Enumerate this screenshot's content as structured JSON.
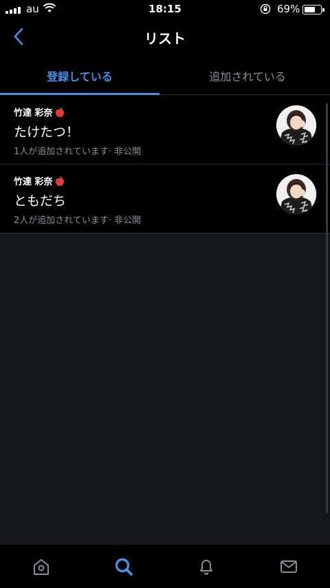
{
  "status": {
    "carrier": "au",
    "time": "18:15",
    "battery_percent": "69%",
    "battery_level": 0.69
  },
  "header": {
    "title": "リスト"
  },
  "tabs": [
    {
      "label": "登録している",
      "active": true
    },
    {
      "label": "追加されている",
      "active": false
    }
  ],
  "lists": [
    {
      "owner": "竹達 彩奈",
      "name": "たけたつ！",
      "meta": "1人が追加されています· 非公開"
    },
    {
      "owner": "竹達 彩奈",
      "name": "ともだち",
      "meta": "2人が追加されています· 非公開"
    }
  ],
  "nav": {
    "items": [
      "home-icon",
      "search-icon",
      "notifications-icon",
      "messages-icon"
    ],
    "active": "search-icon"
  },
  "colors": {
    "accent": "#4a90e2",
    "background": "#000000",
    "empty_area": "#16171a",
    "muted_text": "#8e8e93"
  }
}
